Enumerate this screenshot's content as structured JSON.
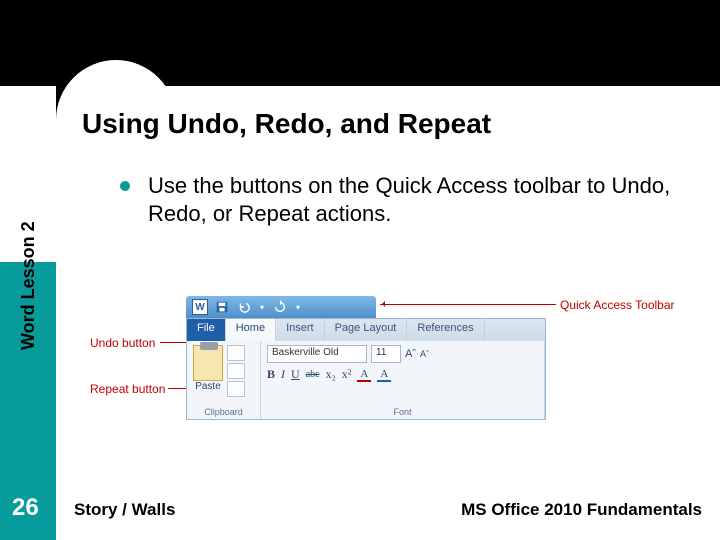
{
  "title": "Using Undo, Redo, and Repeat",
  "bullet": "Use the buttons on the Quick Access toolbar to Undo, Redo, or Repeat actions.",
  "sidebar_label": "Word Lesson 2",
  "page_number": "26",
  "footer": {
    "left": "Story / Walls",
    "right": "MS Office 2010 Fundamentals"
  },
  "callouts": {
    "qat": "Quick Access Toolbar",
    "undo": "Undo button",
    "repeat": "Repeat button"
  },
  "ribbon": {
    "tabs": {
      "file": "File",
      "home": "Home",
      "insert": "Insert",
      "pagelayout": "Page Layout",
      "references": "References"
    },
    "groups": {
      "clipboard": "Clipboard",
      "font": "Font"
    },
    "paste": "Paste",
    "font_name": "Baskerville Old",
    "font_size": "11",
    "aa_grow": "Aˆ",
    "aa_shrink": "Aˇ",
    "b": "B",
    "i": "I",
    "u": "U",
    "abc": "abc",
    "x2": "x²",
    "x2b": "x₂",
    "Aa": "A",
    "Ab": "A"
  },
  "icons": {
    "word_logo": "W",
    "qat_dropdown": "▾"
  }
}
